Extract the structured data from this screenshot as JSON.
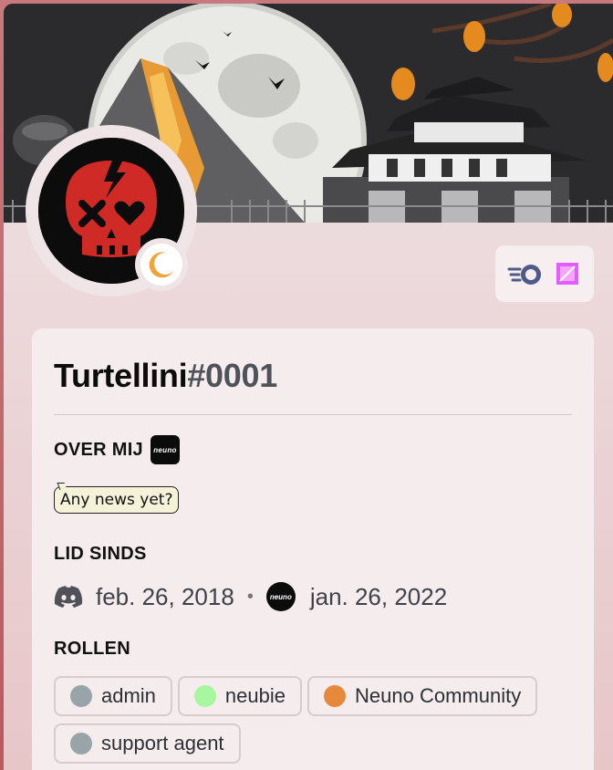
{
  "profile": {
    "username": "Turtellini",
    "discriminator": "#0001",
    "status_icon": "moon-icon"
  },
  "badges": [
    {
      "name": "nitro-badge-icon",
      "color": "#4f5a8a"
    },
    {
      "name": "boost-gem-badge-icon",
      "color": "#e35cff"
    }
  ],
  "about": {
    "title": "OVER MIJ",
    "neuno_logo_text": "neuno",
    "bubble_text": "Any news yet?"
  },
  "member_since": {
    "title": "LID SINDS",
    "discord_date": "feb. 26, 2018",
    "separator": "•",
    "neuno_logo_text": "neuno",
    "server_date": "jan. 26, 2022"
  },
  "roles": {
    "title": "ROLLEN",
    "items": [
      {
        "label": "admin",
        "color": "#99a4a8"
      },
      {
        "label": "neubie",
        "color": "#a8f7a0"
      },
      {
        "label": "Neuno Community",
        "color": "#e8883a"
      },
      {
        "label": "support agent",
        "color": "#99a4a8"
      }
    ]
  }
}
